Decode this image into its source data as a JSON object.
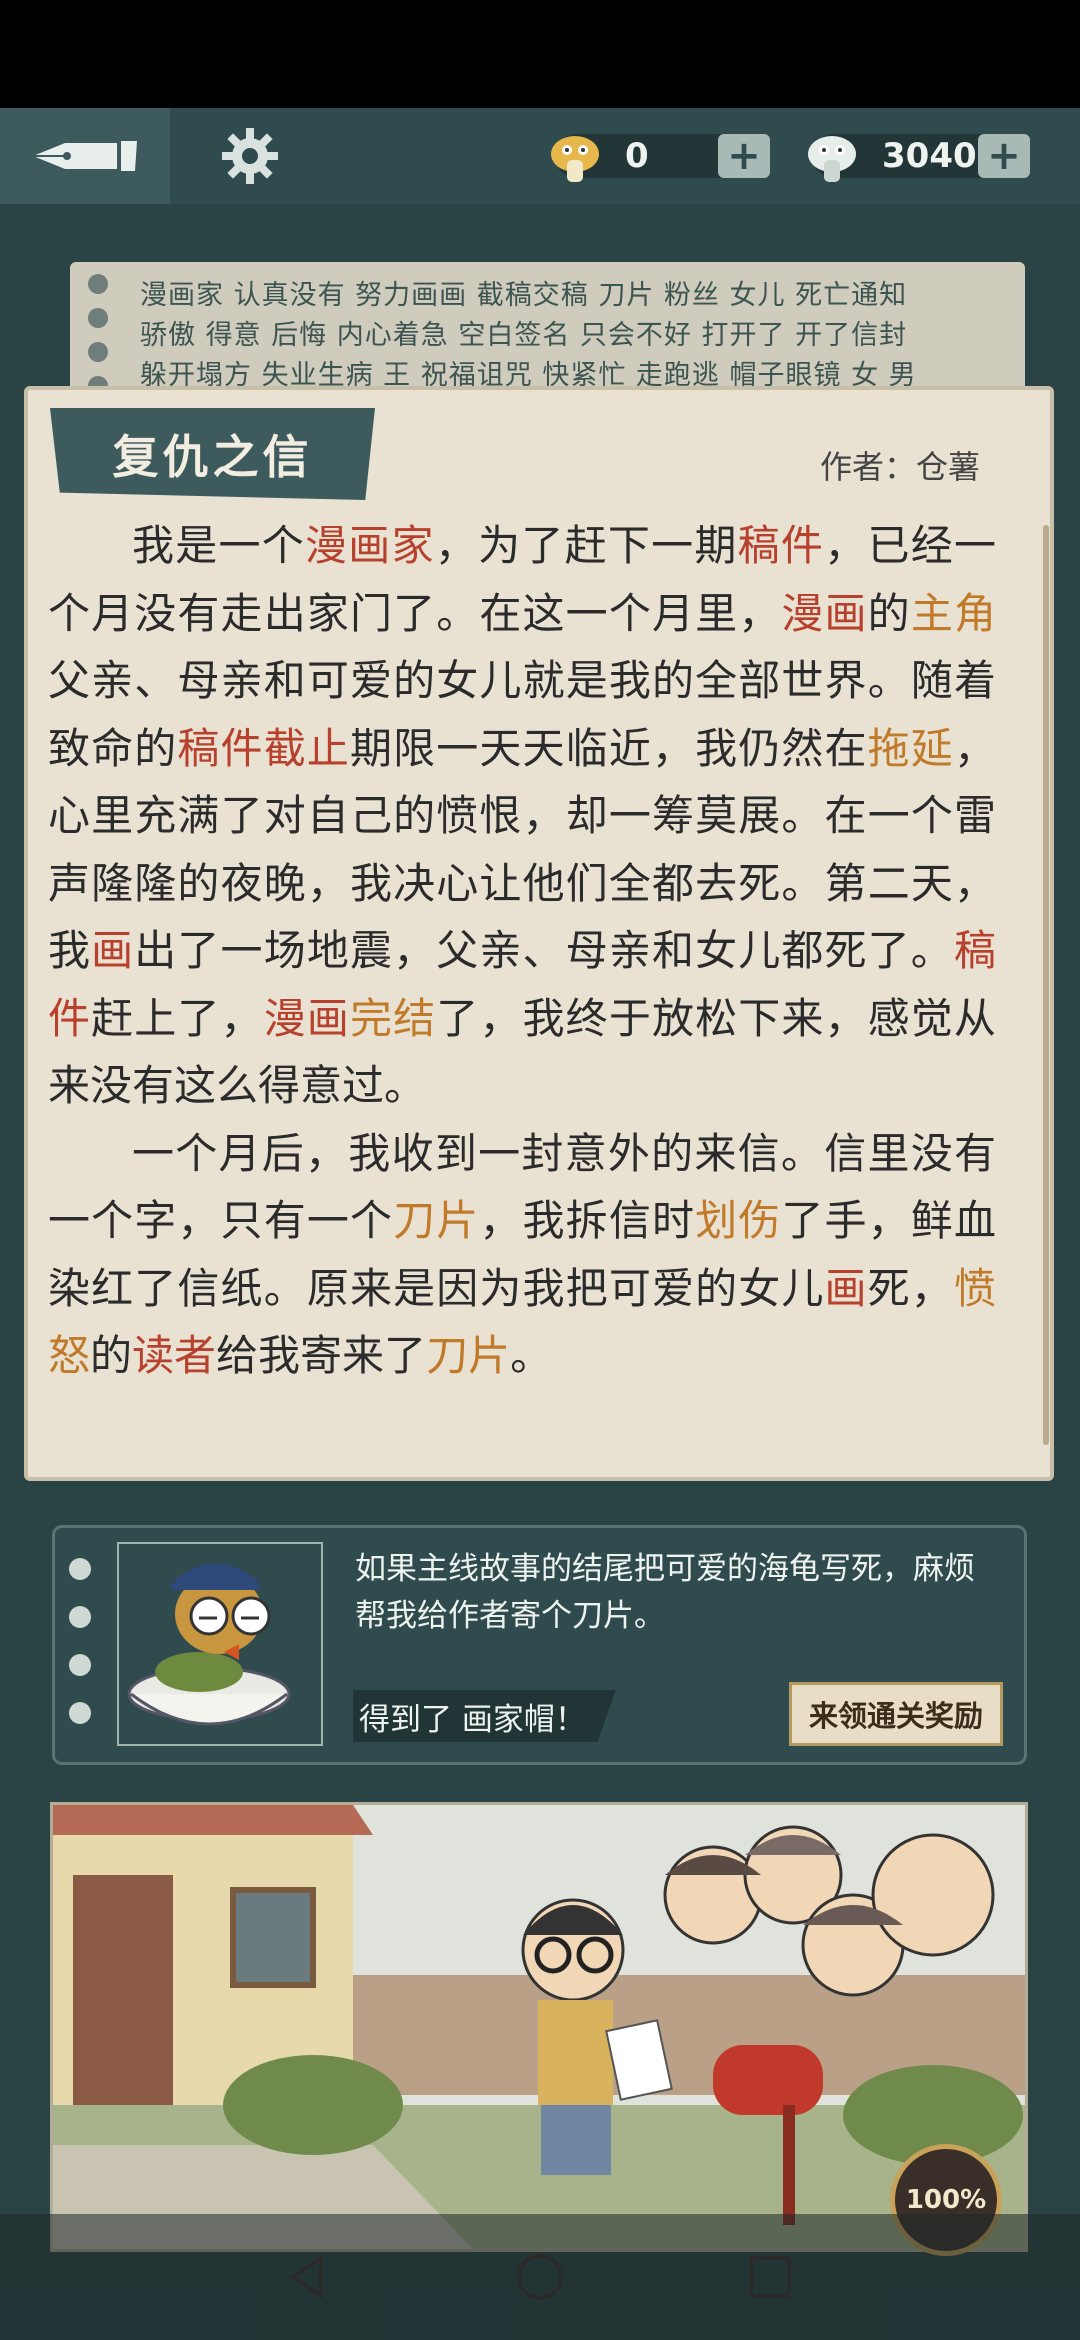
{
  "topbar": {
    "currency1_value": "0",
    "currency2_value": "3040",
    "plus_label": "+"
  },
  "keywords": {
    "line1": "漫画家 认真没有 努力画画 截稿交稿 刀片 粉丝 女儿 死亡通知",
    "line2": "骄傲 得意 后悔 内心着急 空白签名 只会不好 打开了 开了信封",
    "line3": "躲开塌方 失业生病 王 祝福诅咒 快紧忙 走跑逃 帽子眼镜 女 男"
  },
  "story": {
    "title": "复仇之信",
    "author": "作者：仓薯",
    "p1": [
      {
        "t": "我是一个"
      },
      {
        "t": "漫画家",
        "c": "red"
      },
      {
        "t": "，为了赶下一期"
      },
      {
        "t": "稿件",
        "c": "red"
      },
      {
        "t": "，已经一个月没有走出家门了。在这一个月里，"
      },
      {
        "t": "漫画",
        "c": "red"
      },
      {
        "t": "的"
      },
      {
        "t": "主角",
        "c": "org"
      },
      {
        "t": "父亲、母亲和可爱的女儿就是我的全部世界。随着致命的"
      },
      {
        "t": "稿件",
        "c": "red"
      },
      {
        "t": "截止",
        "c": "red"
      },
      {
        "t": "期限一天天临近，我仍然在"
      },
      {
        "t": "拖延",
        "c": "org"
      },
      {
        "t": "，心里充满了对自己的愤恨，却一筹莫展。在一个雷声隆隆的夜晚，我决心让他们全都去死。第二天，我"
      },
      {
        "t": "画",
        "c": "red"
      },
      {
        "t": "出了一场地震，父亲、母亲和女儿都死了。"
      },
      {
        "t": "稿件",
        "c": "red"
      },
      {
        "t": "赶上了，"
      },
      {
        "t": "漫画",
        "c": "red"
      },
      {
        "t": "完结",
        "c": "org"
      },
      {
        "t": "了，我终于放松下来，感觉从来没有这么得意过。"
      }
    ],
    "p2": [
      {
        "t": "一个月后，我收到一封意外的来信。信里没有一个字，只有一个"
      },
      {
        "t": "刀片",
        "c": "org"
      },
      {
        "t": "，我拆信时"
      },
      {
        "t": "划伤",
        "c": "org"
      },
      {
        "t": "了手，鲜血染红了信纸。原来是因为我把可爱的女儿"
      },
      {
        "t": "画",
        "c": "red"
      },
      {
        "t": "死，"
      },
      {
        "t": "愤怒",
        "c": "org"
      },
      {
        "t": "的"
      },
      {
        "t": "读者",
        "c": "red"
      },
      {
        "t": "给我寄来了"
      },
      {
        "t": "刀片",
        "c": "org"
      },
      {
        "t": "。"
      }
    ]
  },
  "hint": {
    "text": "如果主线故事的结尾把可爱的海龟写死，麻烦帮我给作者寄个刀片。",
    "got_label": "得到了 画家帽！",
    "claim_button": "来领通关奖励"
  },
  "progress": {
    "label": "100%",
    "value": 1.0
  },
  "colors": {
    "red": "#b8412e",
    "orange": "#c07a2a",
    "teal": "#2f4b4e"
  }
}
